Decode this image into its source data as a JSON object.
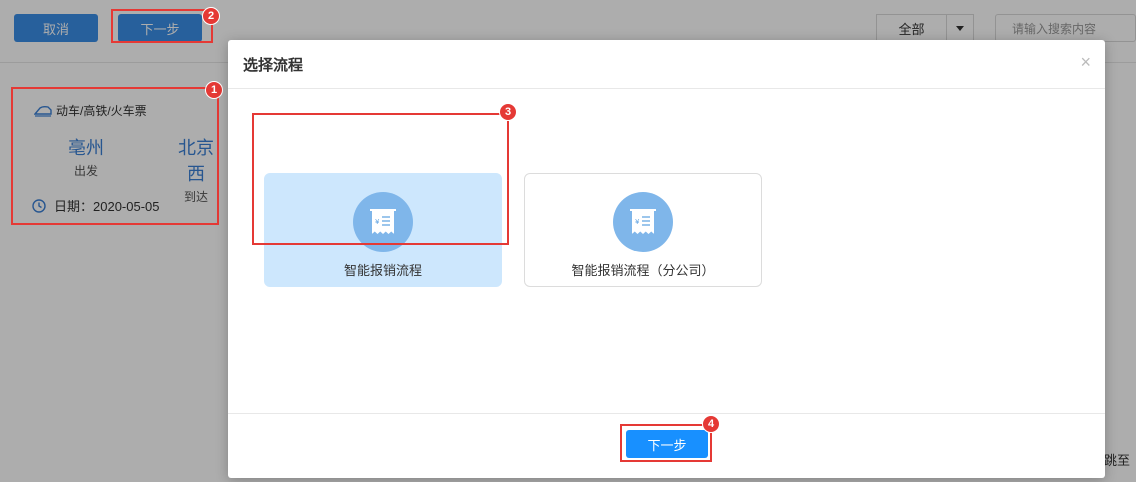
{
  "toolbar": {
    "cancel_label": "取消",
    "next_label": "下一步",
    "filter_value": "全部",
    "search_placeholder": "请输入搜索内容"
  },
  "ticket": {
    "type": "动车/高铁/火车票",
    "from_city": "亳州",
    "from_label": "出发",
    "to_city": "北京西",
    "to_label": "到达",
    "date_text": "日期：2020-05-05"
  },
  "page": {
    "jump_text": "跳至"
  },
  "modal": {
    "title": "选择流程",
    "close_symbol": "×",
    "options": [
      {
        "label": "智能报销流程",
        "selected": true
      },
      {
        "label": "智能报销流程（分公司）",
        "selected": false
      }
    ],
    "next_label": "下一步"
  },
  "callouts": [
    "1",
    "2",
    "3",
    "4"
  ],
  "colors": {
    "primary": "#1890ff",
    "callout": "#e53935",
    "selected_card": "#cde7fd",
    "icon_circle": "#7fb6ea"
  }
}
